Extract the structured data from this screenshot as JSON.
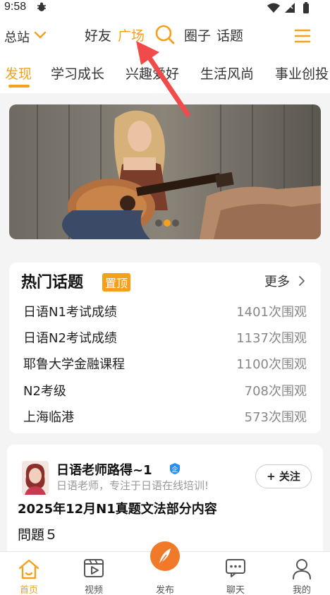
{
  "status_bar": {
    "time": "9:58"
  },
  "top_bar": {
    "region": "总站",
    "nav_friends": "好友",
    "nav_plaza": "广场",
    "nav_circle": "圈子",
    "nav_topic": "话题"
  },
  "categories": [
    {
      "label": "发现",
      "active": true
    },
    {
      "label": "学习成长",
      "active": false
    },
    {
      "label": "兴趣爱好",
      "active": false
    },
    {
      "label": "生活风尚",
      "active": false
    },
    {
      "label": "事业创投",
      "active": false
    }
  ],
  "banner": {
    "dots_count": 3,
    "active_dot": 1
  },
  "hot_topics": {
    "title": "热门话题",
    "pin_badge": "置顶",
    "more_label": "更多",
    "items": [
      {
        "name": "日语N1考试成绩",
        "views": "1401次围观"
      },
      {
        "name": "日语N2考试成绩",
        "views": "1137次围观"
      },
      {
        "name": "耶鲁大学金融课程",
        "views": "1100次围观"
      },
      {
        "name": "N2考级",
        "views": "708次围观"
      },
      {
        "name": "上海临港",
        "views": "573次围观"
      }
    ]
  },
  "post": {
    "author": "日语老师路得~1",
    "verify_badge": "企",
    "bio": "日语老师，专注于日语在线培训!",
    "follow_label": "+ 关注",
    "title": "2025年12月N1真题文法部分内容",
    "body": "問題５"
  },
  "bottom_nav": {
    "home": "首页",
    "video": "视频",
    "publish": "发布",
    "chat": "聊天",
    "me": "我的"
  },
  "colors": {
    "accent": "#f5a01a",
    "arrow": "#f04a4a",
    "verify": "#2a8ef0"
  }
}
